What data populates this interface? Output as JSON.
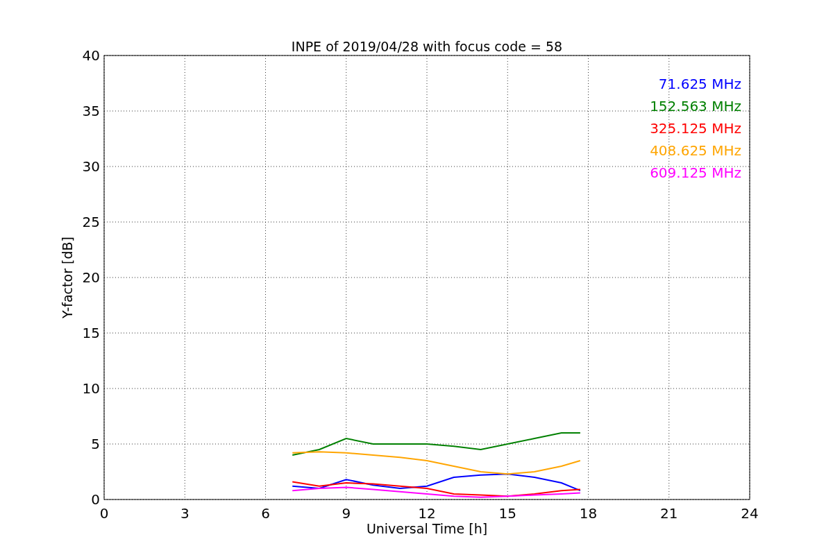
{
  "chart_data": {
    "type": "line",
    "title": "INPE of 2019/04/28 with focus code = 58",
    "xlabel": "Universal Time [h]",
    "ylabel": "Y-factor [dB]",
    "x": [
      7,
      8,
      9,
      10,
      11,
      12,
      13,
      14,
      15,
      16,
      17,
      17.7
    ],
    "series": [
      {
        "name": "71.625 MHz",
        "color": "#0000ff",
        "values": [
          1.2,
          1.0,
          1.8,
          1.3,
          1.0,
          1.2,
          2.0,
          2.2,
          2.3,
          2.0,
          1.5,
          0.8
        ]
      },
      {
        "name": "152.563 MHz",
        "color": "#008000",
        "values": [
          4.0,
          4.5,
          5.5,
          5.0,
          5.0,
          5.0,
          4.8,
          4.5,
          5.0,
          5.5,
          6.0,
          6.0
        ]
      },
      {
        "name": "325.125 MHz",
        "color": "#ff0000",
        "values": [
          1.6,
          1.2,
          1.5,
          1.4,
          1.2,
          1.0,
          0.5,
          0.4,
          0.3,
          0.5,
          0.8,
          0.9
        ]
      },
      {
        "name": "408.625 MHz",
        "color": "#ffa500",
        "values": [
          4.2,
          4.3,
          4.2,
          4.0,
          3.8,
          3.5,
          3.0,
          2.5,
          2.3,
          2.5,
          3.0,
          3.5
        ]
      },
      {
        "name": "609.125 MHz",
        "color": "#ff00ff",
        "values": [
          0.8,
          1.0,
          1.1,
          0.9,
          0.7,
          0.5,
          0.3,
          0.2,
          0.3,
          0.4,
          0.5,
          0.6
        ]
      }
    ],
    "xlim": [
      0,
      24
    ],
    "ylim": [
      0,
      40
    ],
    "xticks": [
      0,
      3,
      6,
      9,
      12,
      15,
      18,
      21,
      24
    ],
    "yticks": [
      0,
      5,
      10,
      15,
      20,
      25,
      30,
      35,
      40
    ],
    "grid": true
  }
}
